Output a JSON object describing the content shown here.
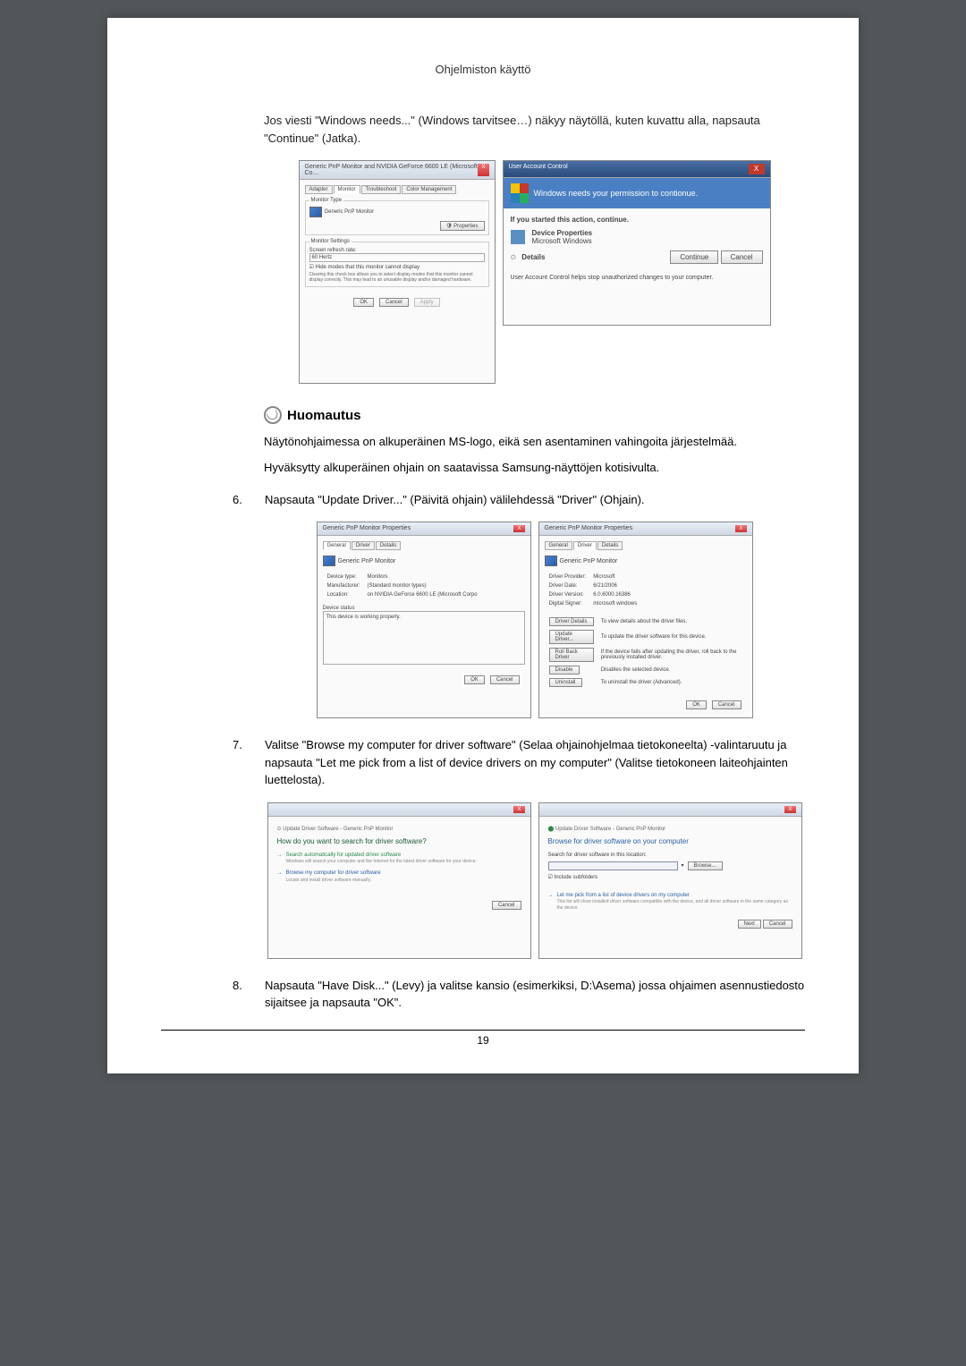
{
  "header": "Ohjelmiston käyttö",
  "intro_paragraph": "Jos viesti \"Windows needs...\" (Windows tarvitsee…) näkyy näytöllä, kuten kuvattu alla, napsauta \"Continue\" (Jatka).",
  "screenshot1": {
    "title": "Generic PnP Monitor and NVIDIA GeForce 6600 LE (Microsoft Co…",
    "tabs": [
      "Adapter",
      "Monitor",
      "Troubleshoot",
      "Color Management"
    ],
    "monitor_type_label": "Monitor Type",
    "monitor_name": "Generic PnP Monitor",
    "properties_btn": "Properties",
    "settings_label": "Monitor Settings",
    "refresh_label": "Screen refresh rate:",
    "refresh_value": "60 Hertz",
    "hide_modes": "Hide modes that this monitor cannot display",
    "hide_desc": "Clearing this check box allows you to select display modes that this monitor cannot display correctly. This may lead to an unusable display and/or damaged hardware.",
    "ok": "OK",
    "cancel": "Cancel",
    "apply": "Apply"
  },
  "uac": {
    "title": "User Account Control",
    "banner": "Windows needs your permission to contionue.",
    "started": "If you started this action, continue.",
    "prop_label": "Device Properties",
    "ms_label": "Microsoft Windows",
    "details": "Details",
    "continue": "Continue",
    "cancel": "Cancel",
    "footer": "User Account Control helps stop unauthorized changes to your computer."
  },
  "note": {
    "heading": "Huomautus",
    "line1": "Näytönohjaimessa on alkuperäinen MS-logo, eikä sen asentaminen vahingoita järjestelmää.",
    "line2": "Hyväksytty alkuperäinen ohjain on saatavissa Samsung-näyttöjen kotisivulta."
  },
  "step6": {
    "num": "6.",
    "text": "Napsauta \"Update Driver...\" (Päivitä ohjain) välilehdessä \"Driver\" (Ohjain)."
  },
  "props_general": {
    "title": "Generic PnP Monitor Properties",
    "tabs": [
      "General",
      "Driver",
      "Details"
    ],
    "monitor_name": "Generic PnP Monitor",
    "labels": {
      "device_type": "Device type:",
      "device_type_val": "Monitors",
      "manufacturer": "Manufacturer:",
      "manufacturer_val": "(Standard monitor types)",
      "location": "Location:",
      "location_val": "on NVIDIA GeForce 6600 LE (Microsoft Corpo"
    },
    "status_label": "Device status",
    "status_text": "This device is working properly.",
    "ok": "OK",
    "cancel": "Cancel"
  },
  "props_driver": {
    "title": "Generic PnP Monitor Properties",
    "tabs": [
      "General",
      "Driver",
      "Details"
    ],
    "monitor_name": "Generic PnP Monitor",
    "labels": {
      "provider": "Driver Provider:",
      "provider_val": "Microsoft",
      "date": "Driver Date:",
      "date_val": "6/21/2006",
      "version": "Driver Version:",
      "version_val": "6.0.6000.16386",
      "signer": "Digital Signer:",
      "signer_val": "microsoft windows"
    },
    "buttons": {
      "details": "Driver Details",
      "details_desc": "To view details about the driver files.",
      "update": "Update Driver...",
      "update_desc": "To update the driver software for this device.",
      "rollback": "Roll Back Driver",
      "rollback_desc": "If the device fails after updating the driver, roll back to the previously installed driver.",
      "disable": "Disable",
      "disable_desc": "Disables the selected device.",
      "uninstall": "Uninstall",
      "uninstall_desc": "To uninstall the driver (Advanced)."
    },
    "ok": "OK",
    "cancel": "Cancel"
  },
  "step7": {
    "num": "7.",
    "text": "Valitse \"Browse my computer for driver software\" (Selaa ohjainohjelmaa tietokoneelta) -valintaruutu ja napsauta \"Let me pick from a list of device drivers on my computer\" (Valitse tietokoneen laiteohjainten luettelosta)."
  },
  "wizard1": {
    "title": "Update Driver Software - Generic PnP Monitor",
    "heading": "How do you want to search for driver software?",
    "opt1": "Search automatically for updated driver software",
    "opt1_desc": "Windows will search your computer and the Internet for the latest driver software for your device.",
    "opt2": "Browse my computer for driver software",
    "opt2_desc": "Locate and install driver software manually.",
    "cancel": "Cancel"
  },
  "wizard2": {
    "title": "Update Driver Software - Generic PnP Monitor",
    "heading": "Browse for driver software on your computer",
    "search_label": "Search for driver software in this location:",
    "browse": "Browse...",
    "include": "Include subfolders",
    "pick": "Let me pick from a list of device drivers on my computer",
    "pick_desc": "This list will show installed driver software compatible with the device, and all driver software in the same category as the device.",
    "next": "Next",
    "cancel": "Cancel"
  },
  "step8": {
    "num": "8.",
    "text": "Napsauta \"Have Disk...\" (Levy) ja valitse kansio (esimerkiksi, D:\\Asema) jossa ohjaimen asennustiedosto sijaitsee ja napsauta \"OK\"."
  },
  "page_number": "19"
}
